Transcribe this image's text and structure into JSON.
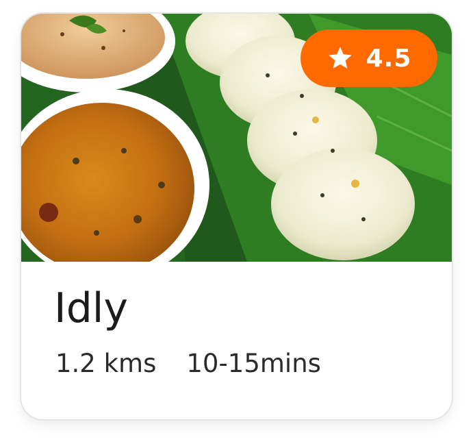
{
  "card": {
    "title": "Idly",
    "distance": "1.2 kms",
    "delivery_time": "10-15mins",
    "rating": {
      "value": "4.5",
      "icon": "star-icon",
      "badge_color": "#ff6a00"
    }
  }
}
